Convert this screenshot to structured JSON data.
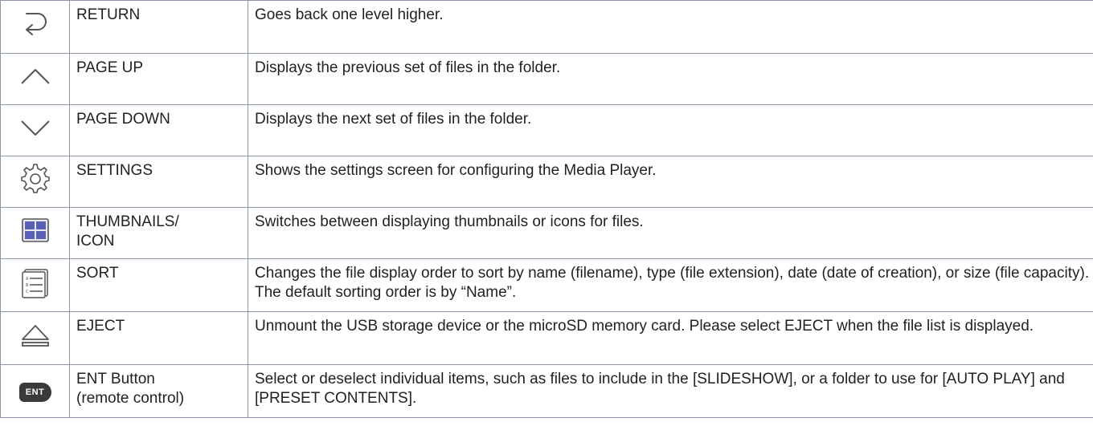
{
  "rows": [
    {
      "icon": "return-icon",
      "name": "RETURN",
      "desc": "Goes back one level higher."
    },
    {
      "icon": "chevron-up-icon",
      "name": "PAGE UP",
      "desc": "Displays the previous set of files in the folder."
    },
    {
      "icon": "chevron-down-icon",
      "name": "PAGE DOWN",
      "desc": "Displays the next set of files in the folder."
    },
    {
      "icon": "gear-icon",
      "name": "SETTINGS",
      "desc": "Shows the settings screen for configuring the Media Player."
    },
    {
      "icon": "thumbnails-grid-icon",
      "name": "THUMBNAILS/\nICON",
      "desc": "Switches between displaying thumbnails or icons for files."
    },
    {
      "icon": "sort-list-icon",
      "name": "SORT",
      "desc": "Changes the file display order to sort by name (filename), type (file extension), date (date of creation), or size (file capacity). The default sorting order is by “Name”."
    },
    {
      "icon": "eject-icon",
      "name": "EJECT",
      "desc": "Unmount the USB storage device or the microSD memory card. Please select EJECT when the file list is displayed."
    },
    {
      "icon": "ent-button-icon",
      "icon_text": "ENT",
      "name": "ENT Button\n(remote control)",
      "desc": "Select or deselect individual items, such as files to include in the [SLIDESHOW], or a folder to use for [AUTO PLAY] and [PRESET CONTENTS]."
    }
  ],
  "colors": {
    "border": "#8a96a8",
    "text": "#231f20",
    "icon_stroke": "#555555",
    "thumb_fill": "#5a5fb8",
    "ent_bg": "#3a3a3a"
  }
}
